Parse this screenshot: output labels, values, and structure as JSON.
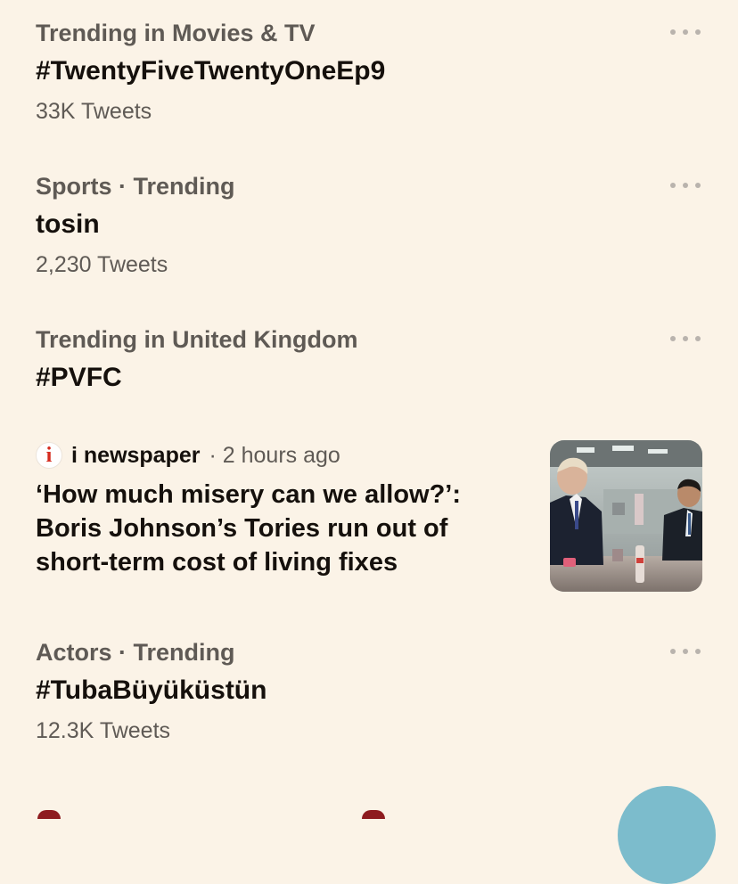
{
  "trends": [
    {
      "meta": "Trending in Movies & TV",
      "topic": "#TwentyFiveTwentyOneEp9",
      "count": "33K Tweets"
    },
    {
      "meta": "Sports · Trending",
      "topic": "tosin",
      "count": "2,230 Tweets"
    },
    {
      "meta": "Trending in United Kingdom",
      "topic": "#PVFC",
      "count": ""
    },
    {
      "meta": "Actors · Trending",
      "topic": "#TubaBüyüküstün",
      "count": "12.3K Tweets"
    }
  ],
  "news": {
    "source_logo": "i",
    "source": "i newspaper",
    "time": "· 2 hours ago",
    "headline": "‘How much misery can we allow?’: Boris Johnson’s Tories run out of short-term cost of living fixes",
    "thumbnail_icon": "news-photo"
  },
  "icons": {
    "more": "more-dots-icon",
    "compose": "compose-fab"
  },
  "colors": {
    "background": "#fbf3e7",
    "secondary_text": "#5f5a55",
    "primary_text": "#15100c",
    "fab": "#7cbccc",
    "logo_red": "#d52b1e"
  }
}
